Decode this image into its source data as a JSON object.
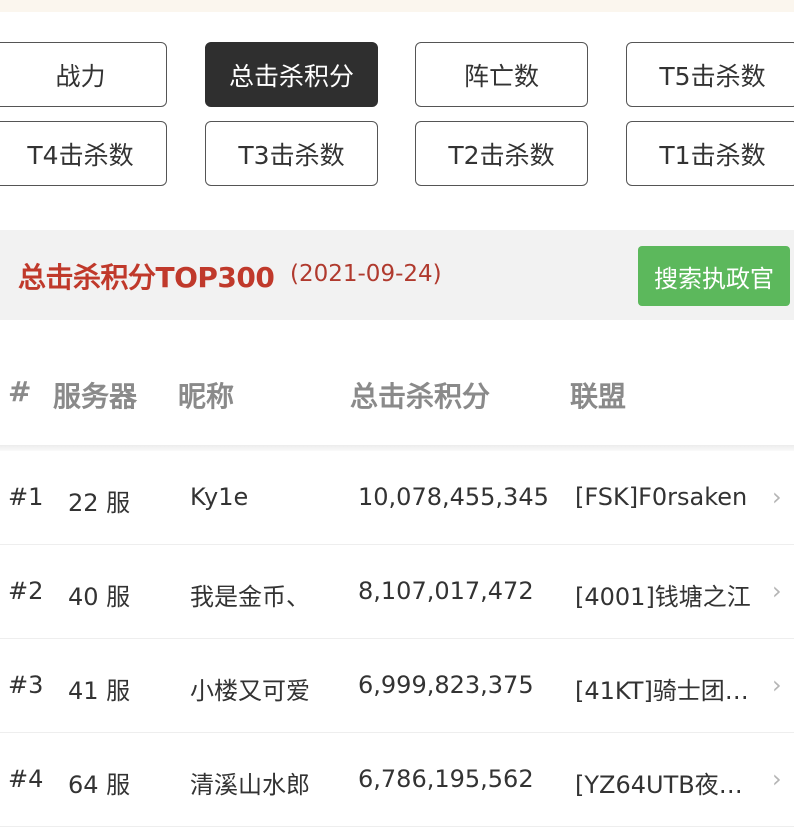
{
  "filters": [
    {
      "label": "战力",
      "active": false
    },
    {
      "label": "总击杀积分",
      "active": true
    },
    {
      "label": "阵亡数",
      "active": false
    },
    {
      "label": "T5击杀数",
      "active": false
    },
    {
      "label": "T4击杀数",
      "active": false
    },
    {
      "label": "T3击杀数",
      "active": false
    },
    {
      "label": "T2击杀数",
      "active": false
    },
    {
      "label": "T1击杀数",
      "active": false
    }
  ],
  "ranking": {
    "title": "总击杀积分TOP300",
    "date": "(2021-09-24)",
    "search_label": "搜索执政官"
  },
  "table": {
    "headers": {
      "rank": "#",
      "server": "服务器",
      "nickname": "昵称",
      "score": "总击杀积分",
      "alliance": "联盟"
    },
    "rows": [
      {
        "rank": "#1",
        "server": "22 服",
        "nickname": "Ky1e",
        "score": "10,078,455,345",
        "alliance": "[FSK]F0rsaken"
      },
      {
        "rank": "#2",
        "server": "40 服",
        "nickname": "我是金币、",
        "score": "8,107,017,472",
        "alliance": "[4001]钱塘之江"
      },
      {
        "rank": "#3",
        "server": "41 服",
        "nickname": "小楼又可爱",
        "score": "6,999,823,375",
        "alliance": "[41KT]骑士团…"
      },
      {
        "rank": "#4",
        "server": "64 服",
        "nickname": "清溪山水郎",
        "score": "6,786,195,562",
        "alliance": "[YZ64UTB夜…"
      }
    ]
  },
  "icons": {
    "row_arrow": "chevron-right-icon"
  },
  "colors": {
    "active_filter_bg": "#2f2f2f",
    "title_red": "#c0392b",
    "search_green": "#5cb85c"
  }
}
